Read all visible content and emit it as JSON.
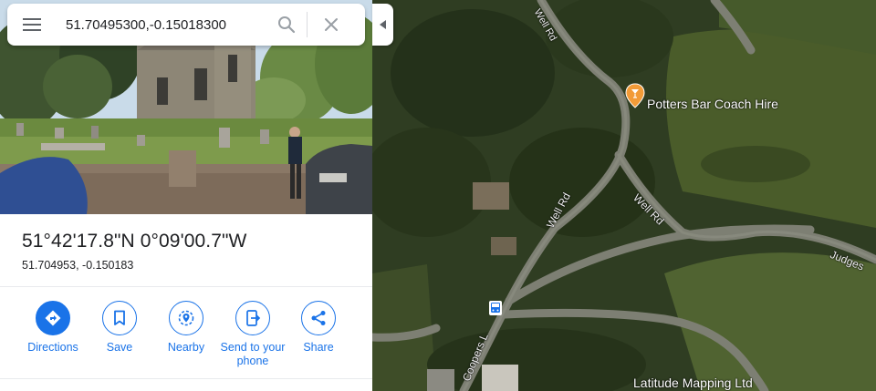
{
  "search": {
    "query": "51.70495300,-0.15018300",
    "menu_icon": "hamburger-menu-icon",
    "search_icon": "search-icon",
    "close_icon": "close-icon"
  },
  "place": {
    "title": "51°42'17.8\"N 0°09'00.7\"W",
    "decimal_coords": "51.704953, -0.150183"
  },
  "actions": [
    {
      "label": "Directions",
      "icon": "directions-icon"
    },
    {
      "label": "Save",
      "icon": "bookmark-icon"
    },
    {
      "label": "Nearby",
      "icon": "nearby-icon"
    },
    {
      "label": "Send to your phone",
      "icon": "send-to-phone-icon"
    },
    {
      "label": "Share",
      "icon": "share-icon"
    }
  ],
  "map": {
    "poi_label": "Potters Bar Coach Hire",
    "poi_icon": "cocktail-bar-pin-icon",
    "business_label": "Latitude Mapping Ltd",
    "bus_stop_icon": "bus-stop-icon",
    "roads": {
      "well_rd_a": "Well Rd",
      "well_rd_b": "Well Rd",
      "well_rd_c": "Well Rd",
      "coopers": "Coopers L",
      "judges": "Judges"
    }
  },
  "colors": {
    "accent": "#1a73e8",
    "poi": "#f29b38"
  }
}
